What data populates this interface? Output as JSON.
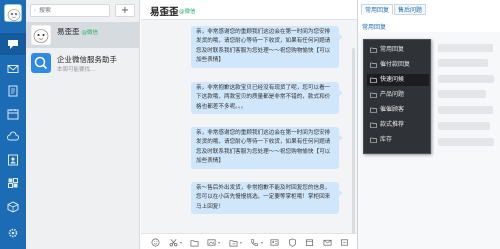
{
  "search": {
    "placeholder": "搜索"
  },
  "contacts": [
    {
      "name": "易歪歪",
      "tag": "@微信",
      "message": ""
    },
    {
      "name": "企业微信服务助手",
      "tag": "",
      "message": "本周可能要找..."
    }
  ],
  "chat": {
    "title": "易歪歪",
    "tag": "@微信",
    "messages": [
      "亲，非常感谢您的重顾我们这边会在第一时间为您安排发货的哦，请您耐心等待一下收货，如果有任何问题请您及时联系我们客服为您处理～～祝您购物愉快【可以加些表情】",
      "亲，非常抱歉这款宝贝已经没有现货了呢，您可以看一下这款哦，两款宝贝的质量都是非常不错的，款式和价格也都差不多呢。。。",
      "亲，非常感谢您的重顾我们这边会在第一时间为您安排发货的哦，请您耐心等待一下收货，如果有任何问题请您及时联系我们客服为您处理～～祝您购物愉快【可以加些表情】",
      "亲～售后外出发货，非常抱歉不能及时回复您的信息，您可以在小店先慢慢挑选，一定要等掌柜哦！掌柜回来马上回复！"
    ]
  },
  "quick_panel": {
    "tabs": [
      "常用回复",
      "售后问题"
    ],
    "section": "常用回复",
    "menu": [
      "常用回复",
      "催付款回复",
      "快速问候",
      "产品问题",
      "催催顾客",
      "款式推荐",
      "库存"
    ],
    "menu_highlight_index": 2
  },
  "colors": {
    "sidebar": "#1c6bb5",
    "bubble": "#cfe6fb",
    "menu_bg": "#2f3237",
    "wechat_green": "#2aae67"
  }
}
